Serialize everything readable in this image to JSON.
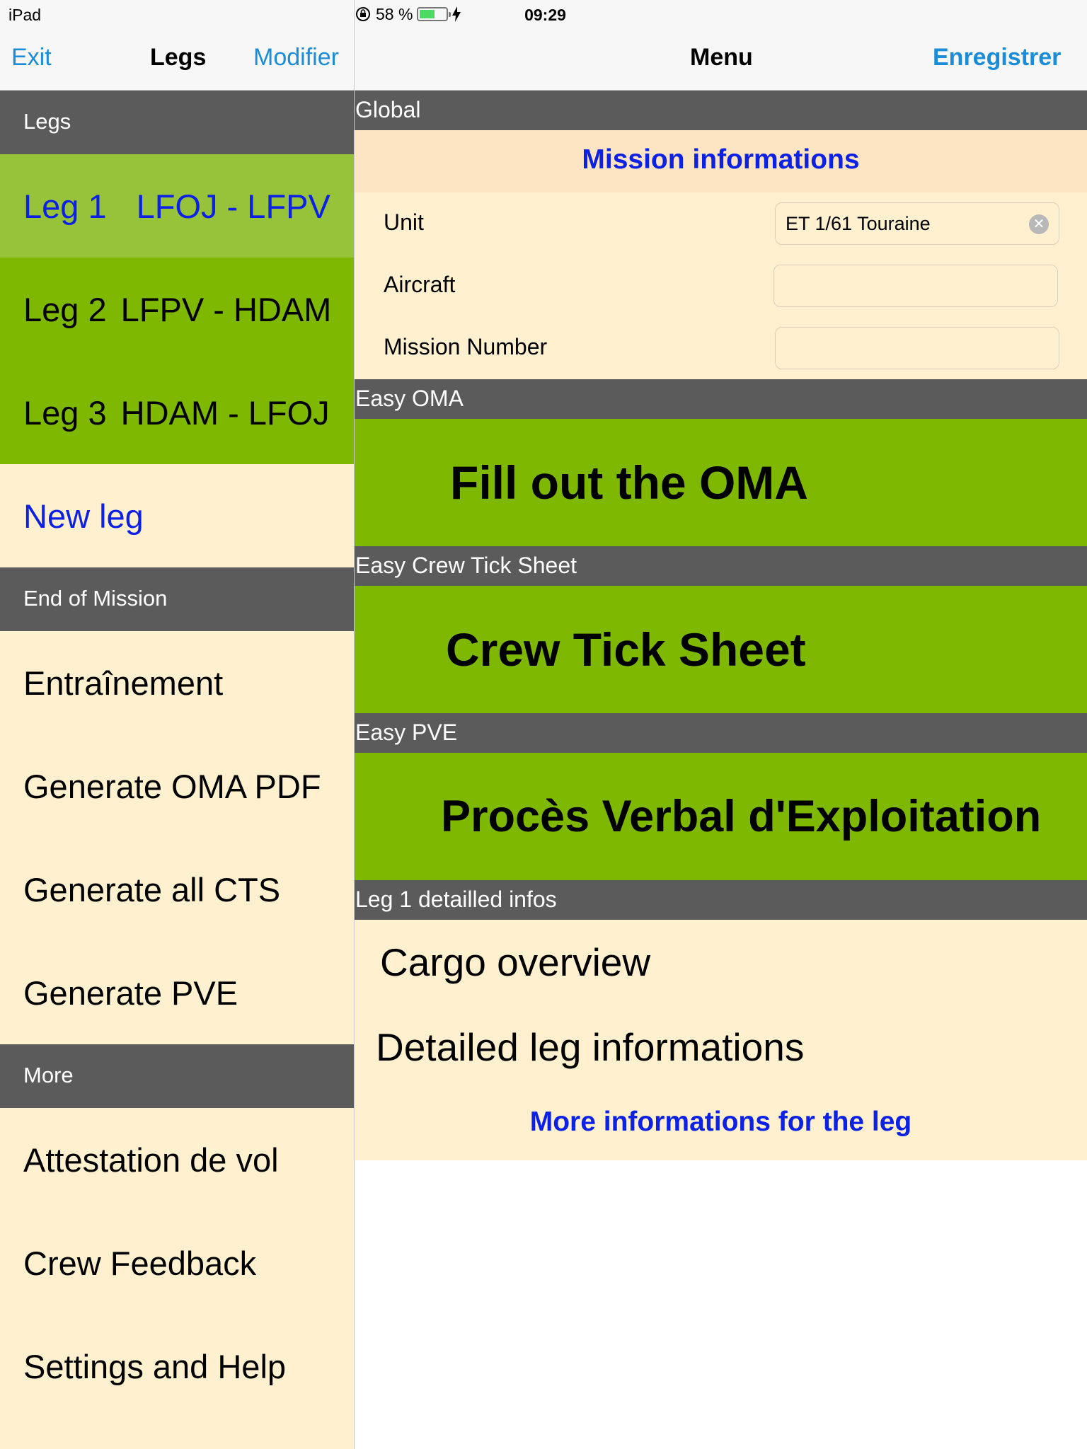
{
  "status_bar": {
    "device": "iPad",
    "time": "09:29",
    "battery": "58 %",
    "battery_level": 0.58
  },
  "left_nav": {
    "exit": "Exit",
    "title": "Legs",
    "modify": "Modifier"
  },
  "right_nav": {
    "title": "Menu",
    "save": "Enregistrer"
  },
  "left": {
    "legs_header": "Legs",
    "legs": [
      {
        "label": "Leg 1",
        "route": "LFOJ - LFPV"
      },
      {
        "label": "Leg 2",
        "route": "LFPV - HDAM"
      },
      {
        "label": "Leg 3",
        "route": "HDAM - LFOJ"
      }
    ],
    "new_leg": "New leg",
    "end_header": "End of Mission",
    "end_items": [
      "Entraînement",
      "Generate OMA PDF",
      "Generate all CTS",
      "Generate PVE"
    ],
    "more_header": "More",
    "more_items": [
      "Attestation de vol",
      "Crew Feedback",
      "Settings and Help"
    ]
  },
  "right": {
    "global_header": "Global",
    "mission_info_title": "Mission informations",
    "fields": [
      {
        "label": "Unit",
        "value": "ET 1/61 Touraine"
      },
      {
        "label": "Aircraft",
        "value": ""
      },
      {
        "label": "Mission Number",
        "value": ""
      }
    ],
    "oma_header": "Easy OMA",
    "oma_button": "Fill out the OMA",
    "cts_header": "Easy Crew Tick Sheet",
    "cts_button": "Crew Tick Sheet",
    "pve_header": "Easy PVE",
    "pve_button": "Procès Verbal d'Exploitation",
    "leg_header": "Leg 1 detailled infos",
    "cargo": "Cargo overview",
    "detailed": "Detailed leg informations",
    "more_link": "More informations for the leg"
  },
  "colors": {
    "section_gray": "#5b5b5b",
    "cream": "#fff1d0",
    "mission_header_bg": "#fde4c2",
    "green": "#7fb800",
    "selected_green": "#97c33b",
    "link_blue": "#0c21e3",
    "ios_blue": "#1a8cd8"
  }
}
